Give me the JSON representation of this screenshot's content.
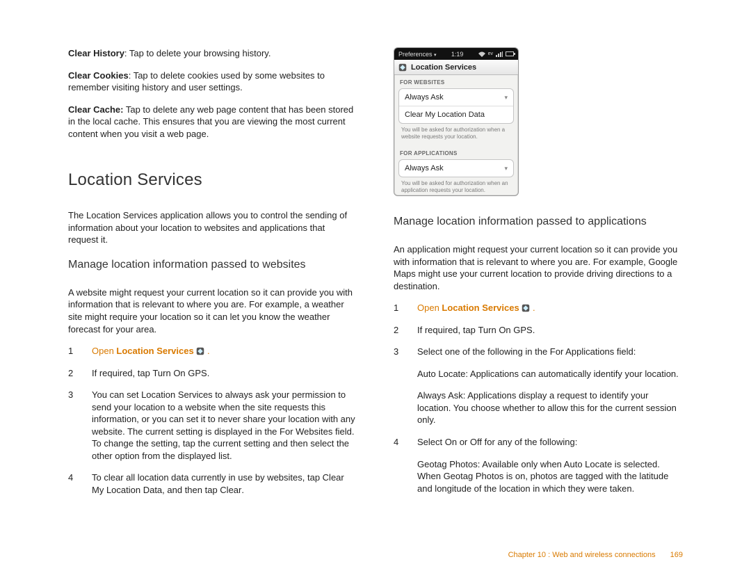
{
  "left": {
    "defs": [
      {
        "term": "Clear History",
        "text": ": Tap to delete your browsing history."
      },
      {
        "term": "Clear Cookies",
        "text": ": Tap to delete cookies used by some websites to remember visiting history and user settings."
      },
      {
        "term": "Clear Cache:",
        "text": " Tap to delete any web page content that has been stored in the local cache. This ensures that you are viewing the most current content when you visit a web page."
      }
    ],
    "heading": "Location Services",
    "intro": "The Location Services application allows you to control the sending of information about your location to websites and applications that request it.",
    "subheading": "Manage location information passed to websites",
    "subintro": "A website might request your current location so it can provide you with information that is relevant to where you are. For example, a weather site might require your location so it can let you know the weather forecast for your area.",
    "step1_pre": "Open ",
    "step1_bold": "Location Services",
    "step1_post": " .",
    "step2_pre": "If required, tap ",
    "step2_bold": "Turn On GPS",
    "step2_post": ".",
    "step3": "You can set Location Services to always ask your permission to send your location to a website when the site requests this information, or you can set it to never share your location with any website. The current setting is displayed in the For Websites field. To change the setting, tap the current setting and then select the other option from the displayed list.",
    "step4_pre": "To clear all location data currently in use by websites, tap ",
    "step4_b1": "Clear My Location Data",
    "step4_mid": ", and then tap ",
    "step4_b2": "Clear",
    "step4_post": "."
  },
  "right": {
    "subheading": "Manage location information passed to applications",
    "intro": "An application might request your current location so it can provide you with information that is relevant to where you are. For example, Google Maps might use your current location to provide driving directions to a destination.",
    "step1_pre": "Open ",
    "step1_bold": "Location Services",
    "step1_post": " .",
    "step2_pre": "If required, tap ",
    "step2_bold": "Turn On GPS",
    "step2_post": ".",
    "step3": "Select one of the following in the For Applications field:",
    "opt1_term": "Auto Locate:",
    "opt1_text": " Applications can automatically identify your location.",
    "opt2_term": "Always Ask:",
    "opt2_text": " Applications display a request to identify your location. You choose whether to allow this for the current session only.",
    "step4_pre": "Select ",
    "step4_b1": "On",
    "step4_mid": " or ",
    "step4_b2": "Off",
    "step4_post": " for any of the following:",
    "opt3_term": "Geotag Photos:",
    "opt3_text": " Available only when Auto Locate is selected. When Geotag Photos is on, photos are tagged with the latitude and longitude of the location in which they were taken."
  },
  "phone": {
    "menu": "Preferences",
    "time": "1:19",
    "title": "Location Services",
    "sect1": "For Websites",
    "row1": "Always Ask",
    "row2": "Clear My Location Data",
    "hint1": "You will be asked for authorization when a website requests your location.",
    "sect2": "For Applications",
    "row3": "Always Ask",
    "hint2": "You will be asked for authorization when an application requests your location."
  },
  "footer": {
    "text": "Chapter 10  :  Web and wireless connections",
    "page": "169"
  },
  "icons": {
    "name": "location-services-icon"
  }
}
